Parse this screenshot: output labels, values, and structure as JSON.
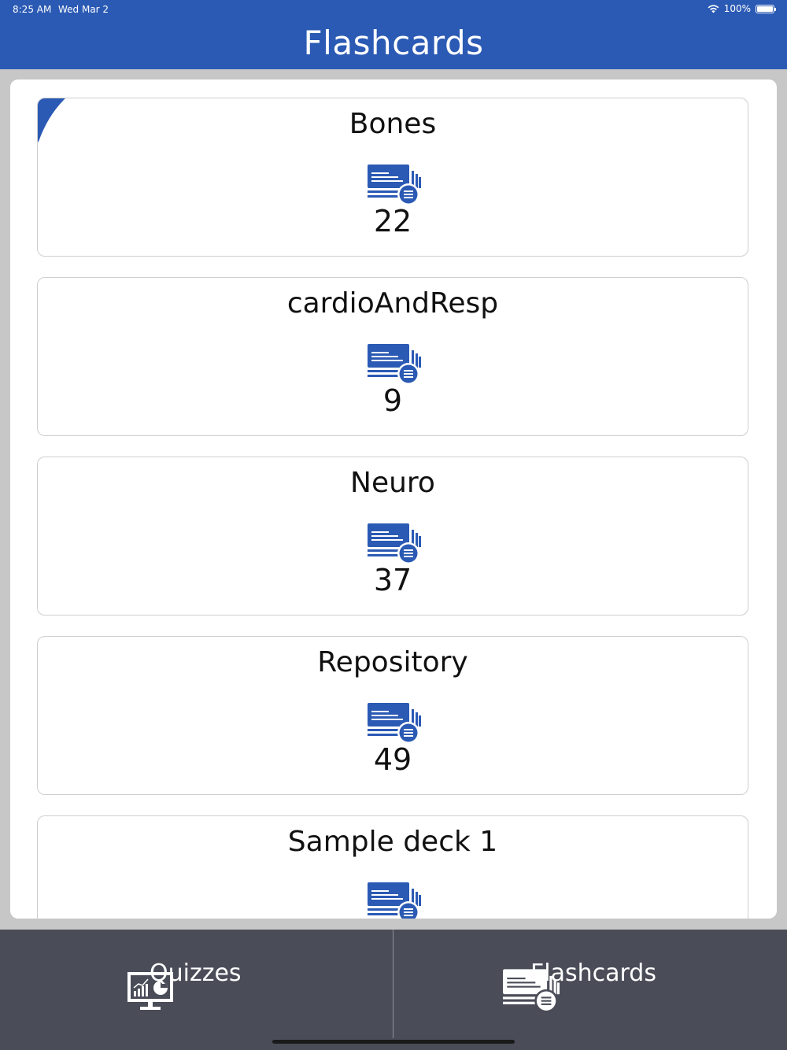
{
  "status_bar": {
    "time": "8:25 AM",
    "date": "Wed Mar 2",
    "battery": "100%"
  },
  "nav": {
    "title": "Flashcards"
  },
  "decks": [
    {
      "name": "Bones",
      "count": "22",
      "icon": "flashcards-icon"
    },
    {
      "name": "cardioAndResp",
      "count": "9",
      "icon": "flashcards-icon"
    },
    {
      "name": "Neuro",
      "count": "37",
      "icon": "flashcards-icon"
    },
    {
      "name": "Repository",
      "count": "49",
      "icon": "flashcards-icon"
    },
    {
      "name": "Sample deck 1",
      "count": "",
      "icon": "flashcards-icon"
    }
  ],
  "tabs": [
    {
      "label": "Quizzes",
      "icon": "quiz-chart-icon"
    },
    {
      "label": "Flashcards",
      "icon": "flashcards-icon"
    }
  ],
  "colors": {
    "accent": "#2b5ab4",
    "tabbar": "#4a4d58",
    "background": "#c7c7c7"
  }
}
